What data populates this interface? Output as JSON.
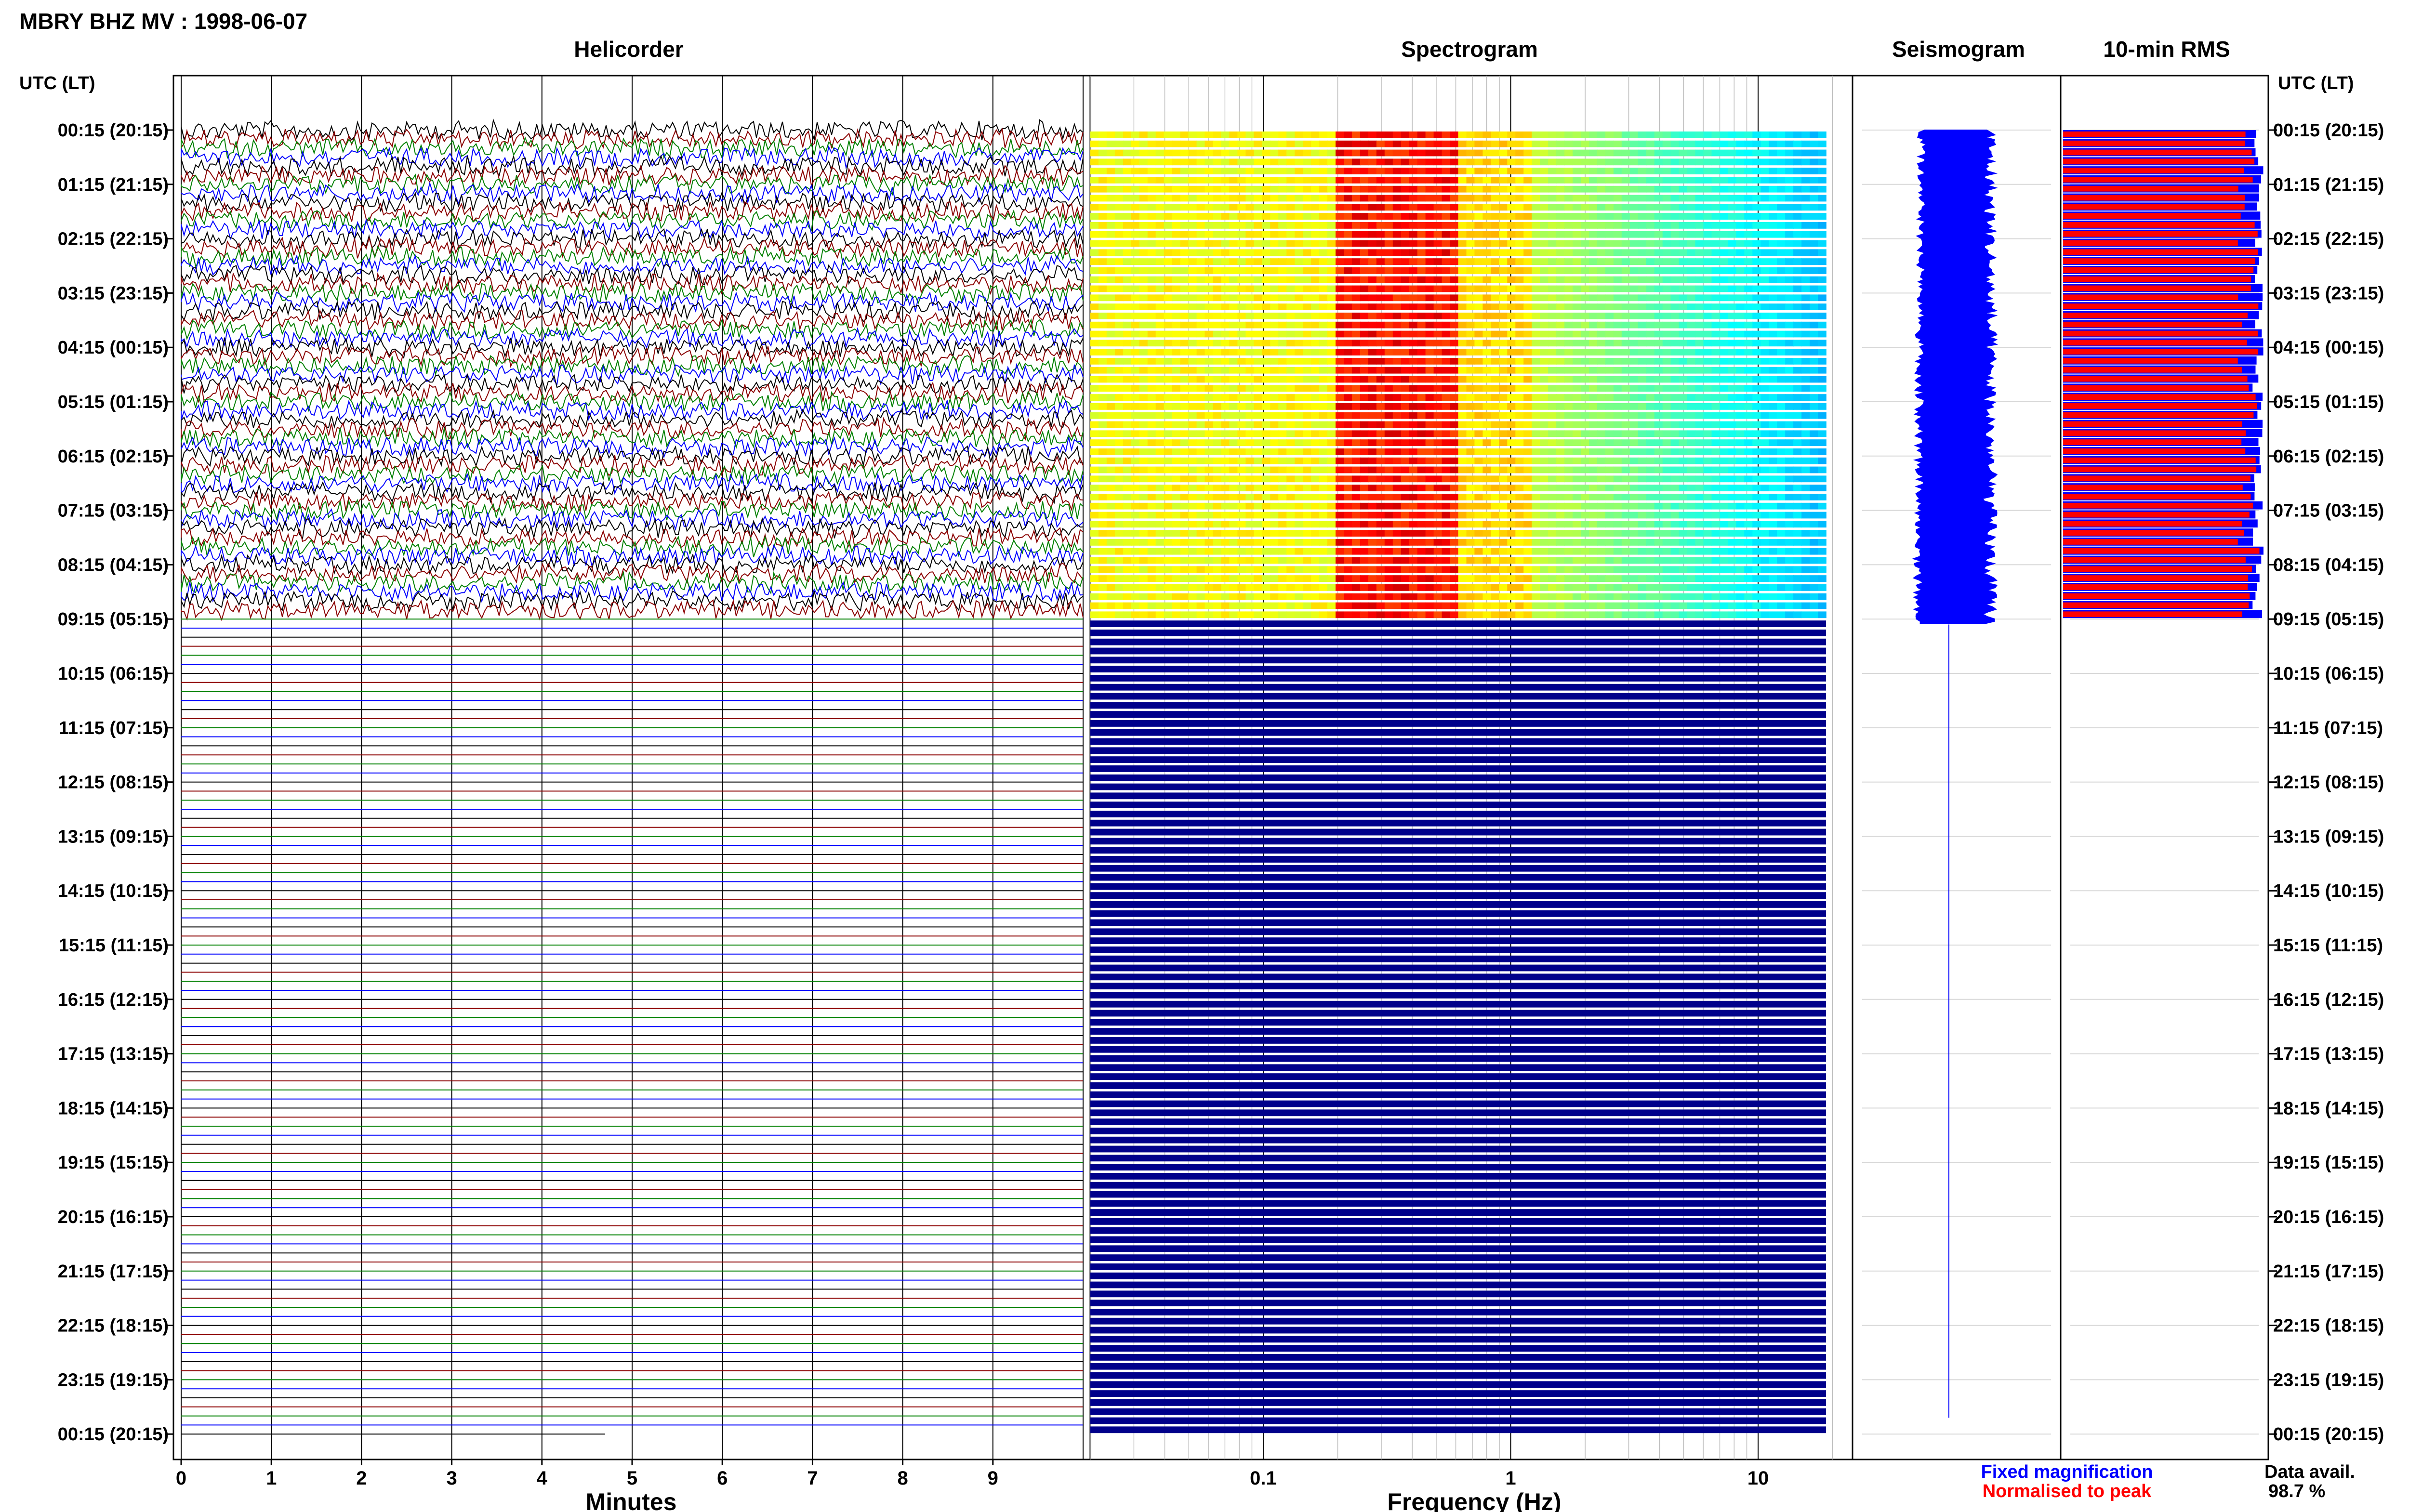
{
  "header": {
    "title": "MBRY BHZ MV : 1998-06-07"
  },
  "panels": {
    "helicorder": "Helicorder",
    "spectrogram": "Spectrogram",
    "seismogram": "Seismogram",
    "rms": "10-min RMS"
  },
  "time_axis": {
    "label_left": "UTC (LT)",
    "label_right": "UTC (LT)",
    "ticks": [
      "00:15 (20:15)",
      "01:15 (21:15)",
      "02:15 (22:15)",
      "03:15 (23:15)",
      "04:15 (00:15)",
      "05:15 (01:15)",
      "06:15 (02:15)",
      "07:15 (03:15)",
      "08:15 (04:15)",
      "09:15 (05:15)",
      "10:15 (06:15)",
      "11:15 (07:15)",
      "12:15 (08:15)",
      "13:15 (09:15)",
      "14:15 (10:15)",
      "15:15 (11:15)",
      "16:15 (12:15)",
      "17:15 (13:15)",
      "18:15 (14:15)",
      "19:15 (15:15)",
      "20:15 (16:15)",
      "21:15 (17:15)",
      "22:15 (18:15)",
      "23:15 (19:15)",
      "00:15 (20:15)"
    ]
  },
  "legend": {
    "fixed": "Fixed magnification",
    "normalised": "Normalised to peak",
    "fixed_color": "#0000ff",
    "normalised_color": "#ff0000"
  },
  "availability": {
    "label": "Data avail.",
    "value": "98.7 %"
  },
  "chart_data": [
    {
      "type": "line",
      "panel": "Helicorder",
      "xlabel": "Minutes",
      "xticks": [
        "0",
        "1",
        "2",
        "3",
        "4",
        "5",
        "6",
        "7",
        "8",
        "9"
      ],
      "xlim": [
        0,
        10
      ],
      "rows_per_hour": 6,
      "active_rows": 54,
      "last_row_minutes": 4.7,
      "trace_colors": [
        "#000000",
        "#8b0000",
        "#008000",
        "#0000ff"
      ]
    },
    {
      "type": "heatmap",
      "panel": "Spectrogram",
      "xlabel": "Frequency (Hz)",
      "xscale": "log",
      "xticks": [
        "0.1",
        "1",
        "10"
      ],
      "xlim": [
        0.02,
        50
      ],
      "active_rows": 54,
      "peak_band_hz": [
        0.25,
        0.5
      ],
      "empty_color": "#00008b"
    },
    {
      "type": "line",
      "panel": "Seismogram",
      "active_hours": 9.1,
      "color": "#0000ff"
    },
    {
      "type": "bar",
      "panel": "10-min RMS",
      "active_rows": 54,
      "series": [
        {
          "name": "Fixed magnification",
          "color": "#0000ff"
        },
        {
          "name": "Normalised to peak",
          "color": "#ff0000"
        }
      ]
    }
  ]
}
